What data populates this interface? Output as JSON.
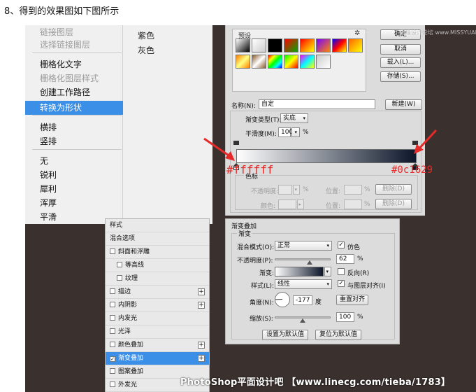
{
  "caption": "8、得到的效果图如下图所示",
  "context_menu": {
    "items": [
      {
        "label": "链接图层",
        "state": "disabled"
      },
      {
        "label": "选择链接图层",
        "state": "disabled"
      },
      {
        "label": "栅格化文字",
        "state": "normal"
      },
      {
        "label": "栅格化图层样式",
        "state": "disabled"
      },
      {
        "label": "创建工作路径",
        "state": "normal"
      },
      {
        "label": "转换为形状",
        "state": "selected"
      },
      {
        "label": "横排",
        "state": "normal"
      },
      {
        "label": "竖排",
        "state": "normal"
      },
      {
        "label": "无",
        "state": "normal"
      },
      {
        "label": "锐利",
        "state": "normal"
      },
      {
        "label": "犀利",
        "state": "normal"
      },
      {
        "label": "浑厚",
        "state": "normal"
      },
      {
        "label": "平滑",
        "state": "normal"
      }
    ]
  },
  "submenu": {
    "items": [
      "紫色",
      "灰色"
    ]
  },
  "gradient_editor": {
    "presets_title": "预设",
    "buttons": {
      "ok": "确定",
      "cancel": "取消",
      "load": "载入(L)...",
      "save": "存储(S)...",
      "new": "新建(W)"
    },
    "name_label": "名称(N):",
    "name_value": "自定",
    "type_label": "渐变类型(T):",
    "type_value": "实底",
    "smoothness_label": "平滑度(M):",
    "smoothness_value": "100",
    "smoothness_unit": "%",
    "stops_legend": "色标",
    "opacity_label": "不透明度:",
    "opacity_unit": "%",
    "location_label": "位置:",
    "delete_label": "删除(D)",
    "color_label": "颜色:",
    "stop_color_left": "#ffffff",
    "stop_color_right": "#0c1629",
    "preset_swatches": [
      "linear-gradient(135deg,#ffffff,#000000)",
      "linear-gradient(135deg,#ffffff 0%,#cccccc 100%)",
      "linear-gradient(135deg,#000000,#000000)",
      "linear-gradient(135deg,#ff0000,#00aa00)",
      "linear-gradient(135deg,#ff0000,#ffff00)",
      "linear-gradient(135deg,#7a00ff,#ff8800)",
      "linear-gradient(135deg,#0000ff,#ff0000,#ffff00)",
      "linear-gradient(135deg,#ff6600,#ffff00)",
      "linear-gradient(135deg,#ff8000,#ffff80,#ff8000)",
      "linear-gradient(135deg,#8a5a2a,#ffffff,#8a5a2a)",
      "linear-gradient(135deg,#ff0000,#ffff00,#00ff00,#00ffff,#0000ff)",
      "linear-gradient(135deg,#00ff00,#ffff00,#ff0000)",
      "linear-gradient(135deg,#ff00ff,#00ffff,#ffff00)",
      "linear-gradient(135deg,#cccccc,#ffffff)"
    ]
  },
  "annotations": {
    "left_hex": "#ffffff",
    "right_hex": "#0c1629",
    "color": "#e62a2a"
  },
  "style_list": {
    "items": [
      {
        "label": "样式",
        "checkbox": false,
        "checked": false,
        "plus": false,
        "selected": false,
        "indent": false
      },
      {
        "label": "混合选项",
        "checkbox": false,
        "checked": false,
        "plus": false,
        "selected": false,
        "indent": false
      },
      {
        "label": "斜面和浮雕",
        "checkbox": true,
        "checked": false,
        "plus": false,
        "selected": false,
        "indent": false
      },
      {
        "label": "等高线",
        "checkbox": true,
        "checked": false,
        "plus": false,
        "selected": false,
        "indent": true
      },
      {
        "label": "纹理",
        "checkbox": true,
        "checked": false,
        "plus": false,
        "selected": false,
        "indent": true
      },
      {
        "label": "描边",
        "checkbox": true,
        "checked": false,
        "plus": true,
        "selected": false,
        "indent": false
      },
      {
        "label": "内阴影",
        "checkbox": true,
        "checked": false,
        "plus": true,
        "selected": false,
        "indent": false
      },
      {
        "label": "内发光",
        "checkbox": true,
        "checked": false,
        "plus": false,
        "selected": false,
        "indent": false
      },
      {
        "label": "光泽",
        "checkbox": true,
        "checked": false,
        "plus": false,
        "selected": false,
        "indent": false
      },
      {
        "label": "颜色叠加",
        "checkbox": true,
        "checked": false,
        "plus": true,
        "selected": false,
        "indent": false
      },
      {
        "label": "渐变叠加",
        "checkbox": true,
        "checked": true,
        "plus": true,
        "selected": true,
        "indent": false
      },
      {
        "label": "图案叠加",
        "checkbox": true,
        "checked": false,
        "plus": false,
        "selected": false,
        "indent": false
      },
      {
        "label": "外发光",
        "checkbox": true,
        "checked": false,
        "plus": false,
        "selected": false,
        "indent": false
      }
    ]
  },
  "gradient_overlay": {
    "panel_title": "渐变叠加",
    "group_title": "渐变",
    "blend_mode_label": "混合模式(O):",
    "blend_mode_value": "正常",
    "dither_label": "仿色",
    "dither_checked": true,
    "opacity_label": "不透明度(P):",
    "opacity_value": "62",
    "opacity_unit": "%",
    "opacity_fraction": 0.62,
    "gradient_label": "渐变:",
    "reverse_label": "反向(R)",
    "reverse_checked": false,
    "style_label": "样式(L):",
    "style_value": "线性",
    "align_label": "与图层对齐(I)",
    "align_checked": true,
    "angle_label": "角度(N):",
    "angle_value": "-177",
    "angle_unit": "度",
    "angle_degrees": -177,
    "reset_align_label": "重置对齐",
    "scale_label": "缩放(S):",
    "scale_value": "100",
    "scale_unit": "%",
    "scale_fraction": 0.5,
    "set_default_label": "设置为默认值",
    "reset_default_label": "复位为默认值"
  },
  "watermark": "PhotoShop平面设计吧 【www.linecg.com/tieba/1783】",
  "corner_watermark": "思缘设计论坛 www.MISSYUAN.COM"
}
